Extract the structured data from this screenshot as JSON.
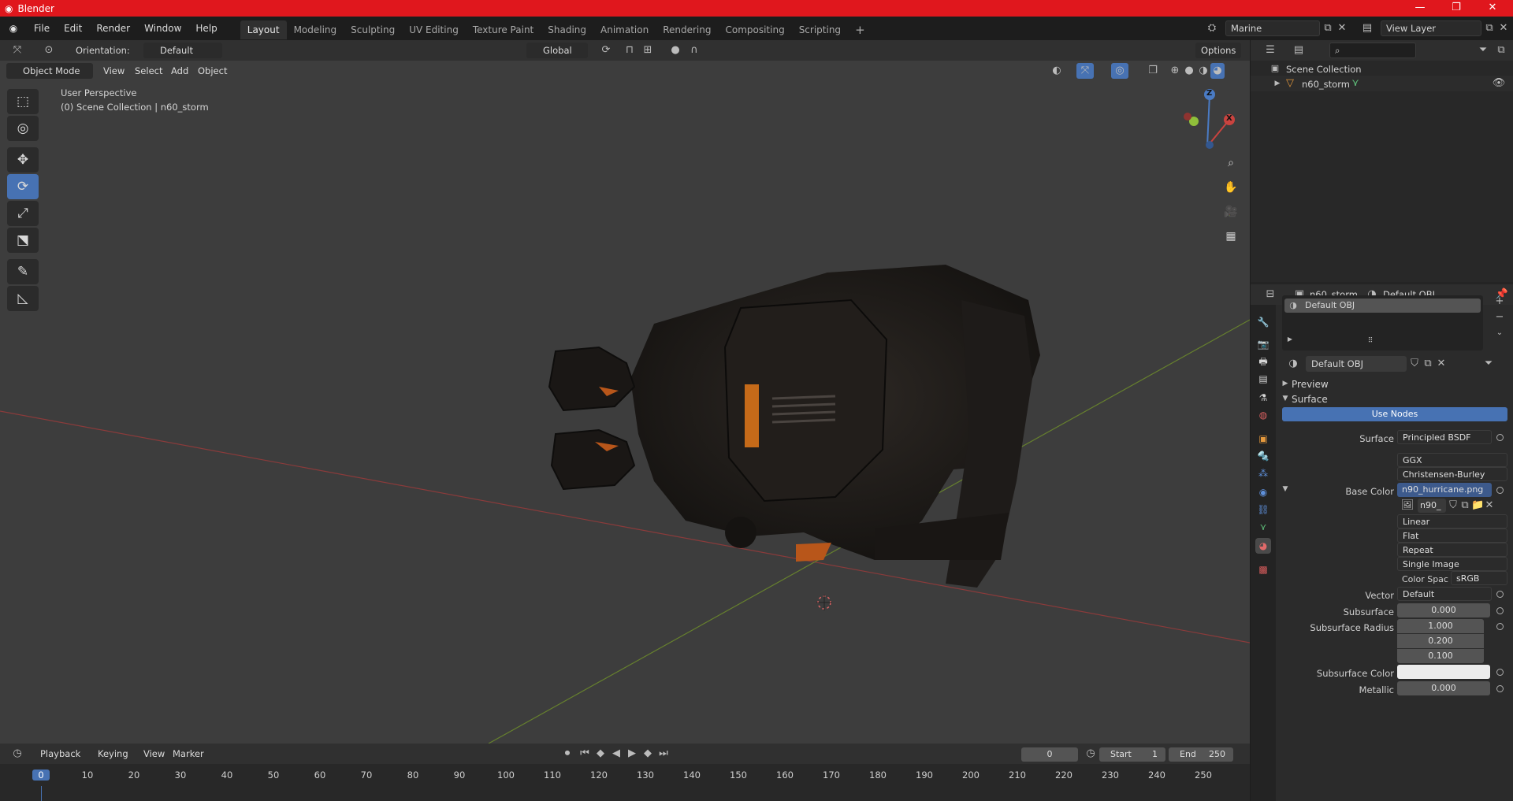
{
  "titlebar": {
    "title": "Blender",
    "minimize": "—",
    "restore": "❐",
    "close": "✕"
  },
  "menu": [
    "File",
    "Edit",
    "Render",
    "Window",
    "Help"
  ],
  "workspaces": [
    "Layout",
    "Modeling",
    "Sculpting",
    "UV Editing",
    "Texture Paint",
    "Shading",
    "Animation",
    "Rendering",
    "Compositing",
    "Scripting"
  ],
  "add_workspace": "+",
  "scene_name": "Marine",
  "view_layer": "View Layer",
  "tool_header": {
    "orientation_label": "Orientation:",
    "orientation_value": "Default",
    "transform_orientation": "Global",
    "options": "Options"
  },
  "viewport_header": {
    "mode": "Object Mode",
    "menus": [
      "View",
      "Select",
      "Add",
      "Object"
    ]
  },
  "viewport": {
    "perspective": "User Perspective",
    "collection": "(0) Scene Collection | n60_storm",
    "gizmo": {
      "z": "Z",
      "x": "X"
    }
  },
  "timeline": {
    "menus": [
      "Playback",
      "Keying",
      "View",
      "Marker"
    ],
    "current_frame": "0",
    "start_label": "Start",
    "start": "1",
    "end_label": "End",
    "end": "250",
    "ticks": [
      "0",
      "10",
      "20",
      "30",
      "40",
      "50",
      "60",
      "70",
      "80",
      "90",
      "100",
      "110",
      "120",
      "130",
      "140",
      "150",
      "160",
      "170",
      "180",
      "190",
      "200",
      "210",
      "220",
      "230",
      "240",
      "250"
    ]
  },
  "outliner": {
    "root": "Scene Collection",
    "items": [
      {
        "name": "n60_storm"
      }
    ]
  },
  "properties": {
    "object_name": "n60_storm",
    "material_name": "Default OBJ",
    "slot": "Default OBJ",
    "material_field": "Default OBJ",
    "panels": {
      "preview": "Preview",
      "surface": "Surface"
    },
    "use_nodes": "Use Nodes",
    "rows": {
      "surface_label": "Surface",
      "surface_value": "Principled BSDF",
      "distribution": "GGX",
      "subsurface_method": "Christensen-Burley",
      "base_color_label": "Base Color",
      "base_color_value": "n90_hurricane.png",
      "image_name": "n90_",
      "interpolation": "Linear",
      "projection": "Flat",
      "extension": "Repeat",
      "source": "Single Image",
      "color_space_label": "Color Spac",
      "color_space_value": "sRGB",
      "vector_label": "Vector",
      "vector_value": "Default",
      "subsurface_label": "Subsurface",
      "subsurface_value": "0.000",
      "subsurface_radius_label": "Subsurface Radius",
      "subsurface_radius": [
        "1.000",
        "0.200",
        "0.100"
      ],
      "subsurface_color_label": "Subsurface Color",
      "metallic_label": "Metallic",
      "metallic_value": "0.000"
    }
  },
  "colors": {
    "accent": "#4772b3",
    "titlebar": "#e0171d",
    "x_axis": "#c9433f",
    "y_axis": "#7a9a35"
  }
}
